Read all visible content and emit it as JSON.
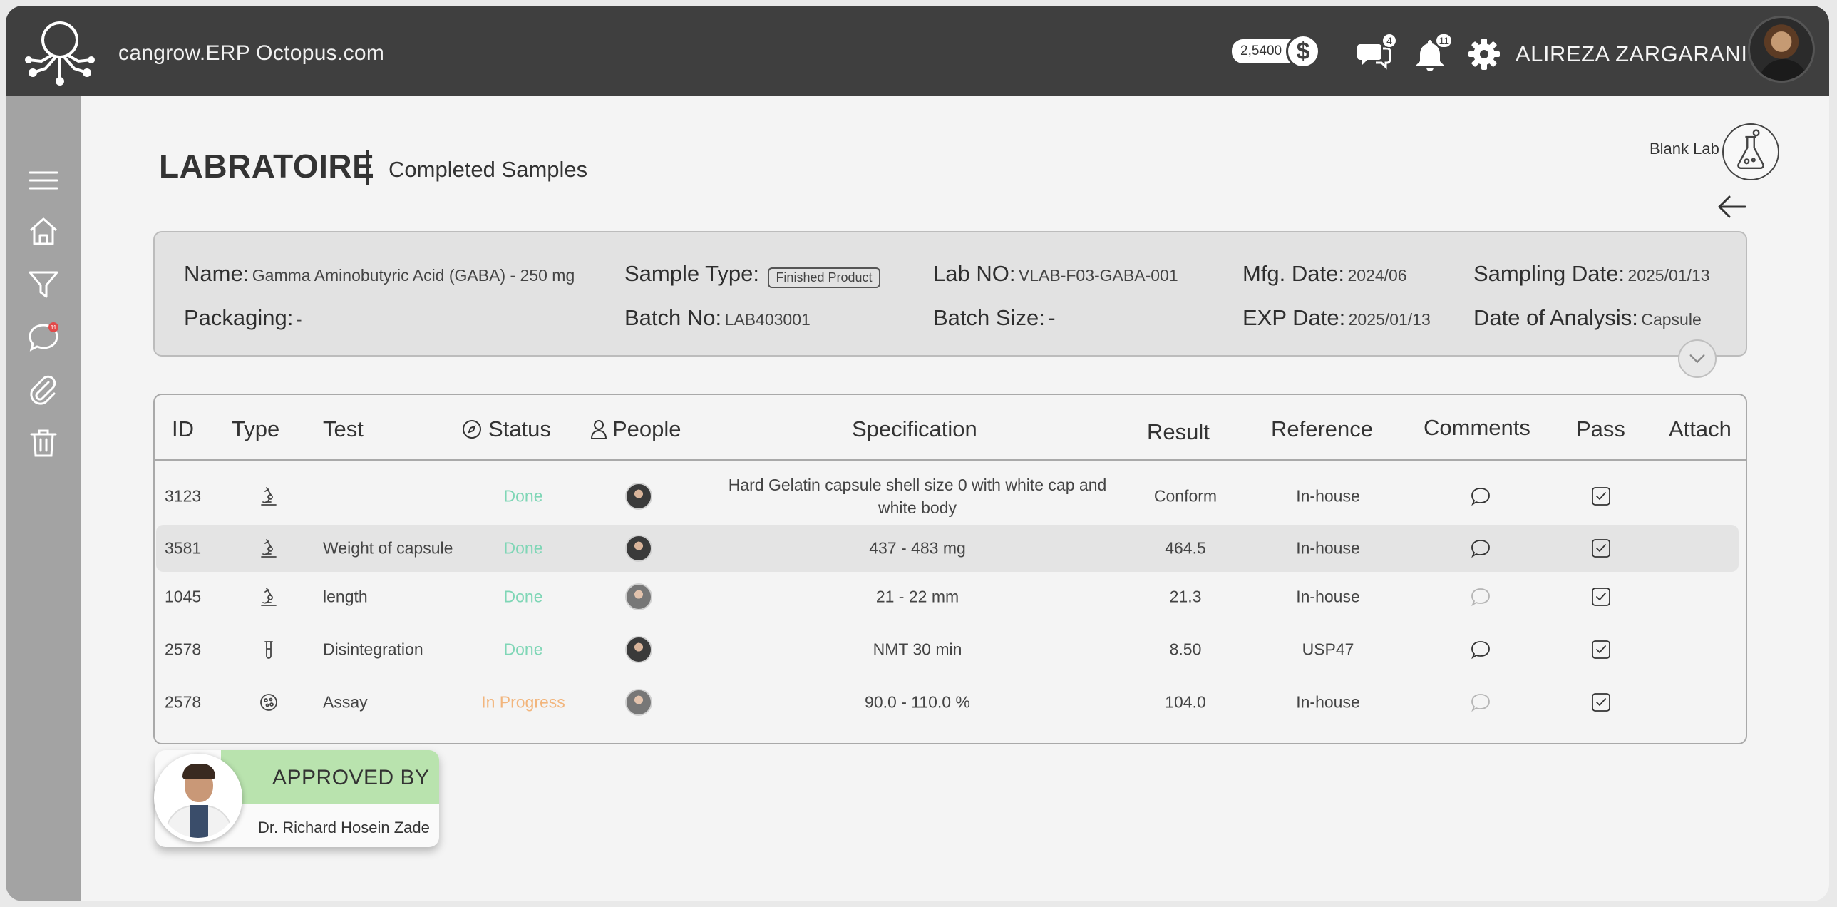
{
  "app": {
    "brand": "cangrow.ERP Octopus.com",
    "balance": "2,5400",
    "currency_symbol": "$",
    "messages_count": "4",
    "notifications_count": "11",
    "user_name": "ALIREZA ZARGARANI"
  },
  "sidebar": {
    "items": [
      {
        "icon": "menu-icon"
      },
      {
        "icon": "home-icon"
      },
      {
        "icon": "filter-icon"
      },
      {
        "icon": "chat-icon",
        "badge": "11"
      },
      {
        "icon": "attachment-icon"
      },
      {
        "icon": "trash-icon"
      }
    ]
  },
  "header": {
    "title": "LABRATOIRE",
    "subtitle": "Completed Samples",
    "blank_lab": "Blank Lab"
  },
  "info": {
    "name_label": "Name:",
    "name_value": "Gamma Aminobutyric Acid (GABA) - 250 mg",
    "sample_type_label": "Sample Type:",
    "sample_type_value": "Finished Product",
    "lab_no_label": "Lab NO:",
    "lab_no_value": "VLAB-F03-GABA-001",
    "mfg_label": "Mfg. Date:",
    "mfg_value": "2024/06",
    "sampling_label": "Sampling Date:",
    "sampling_value": "2025/01/13",
    "packaging_label": "Packaging:",
    "packaging_value": "-",
    "batch_no_label": "Batch No:",
    "batch_no_value": "LAB403001",
    "batch_size_label": "Batch Size:",
    "batch_size_value": "-",
    "exp_label": "EXP Date:",
    "exp_value": "2025/01/13",
    "analysis_label": "Date of Analysis:",
    "analysis_value": "Capsule"
  },
  "table": {
    "headers": {
      "id": "ID",
      "type": "Type",
      "test": "Test",
      "status": "Status",
      "people": "People",
      "specification": "Specification",
      "result": "Result",
      "reference": "Reference",
      "comments": "Comments",
      "pass": "Pass",
      "attach": "Attach"
    },
    "rows": [
      {
        "id": "3123",
        "type_icon": "microscope-icon",
        "test": "",
        "status": "Done",
        "spec": "Hard Gelatin capsule shell size 0 with white cap and white body",
        "result": "Conform",
        "reference": "In-house",
        "comment_active": true,
        "pass": true
      },
      {
        "id": "3581",
        "type_icon": "microscope-icon",
        "test": "Weight of capsule",
        "status": "Done",
        "spec": "437 - 483 mg",
        "result": "464.5",
        "reference": "In-house",
        "comment_active": true,
        "pass": true
      },
      {
        "id": "1045",
        "type_icon": "microscope-icon",
        "test": "length",
        "status": "Done",
        "spec": "21 - 22 mm",
        "result": "21.3",
        "reference": "In-house",
        "comment_active": false,
        "pass": true
      },
      {
        "id": "2578",
        "type_icon": "test-tube-icon",
        "test": "Disintegration",
        "status": "Done",
        "spec": "NMT 30 min",
        "result": "8.50",
        "reference": "USP47",
        "comment_active": true,
        "pass": true
      },
      {
        "id": "2578",
        "type_icon": "petri-dish-icon",
        "test": "Assay",
        "status": "In Progress",
        "spec": "90.0 - 110.0 %",
        "result": "104.0",
        "reference": "In-house",
        "comment_active": false,
        "pass": true
      }
    ]
  },
  "approval": {
    "title": "APPROVED BY",
    "name": "Dr. Richard Hosein Zade"
  },
  "colors": {
    "topbar": "#3f3f3f",
    "sidebar": "#a3a3a3",
    "status_done": "#7fd6b6",
    "status_progress": "#f2b57c",
    "approved_header": "#b9e3ae"
  }
}
